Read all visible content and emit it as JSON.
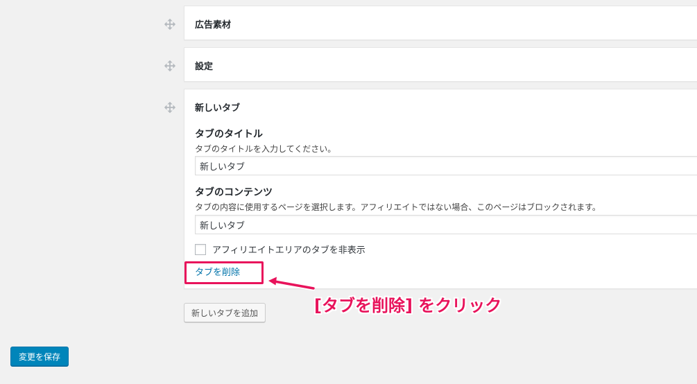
{
  "sections": [
    {
      "title": "広告素材"
    },
    {
      "title": "設定"
    },
    {
      "title": "新しいタブ"
    }
  ],
  "tab_form": {
    "title_label": "タブのタイトル",
    "title_desc": "タブのタイトルを入力してください。",
    "title_value": "新しいタブ",
    "content_label": "タブのコンテンツ",
    "content_desc": "タブの内容に使用するページを選択します。アフィリエイトではない場合、このページはブロックされます。",
    "content_value": "新しいタブ",
    "hide_checkbox_label": "アフィリエイトエリアのタブを非表示",
    "hide_checked": false,
    "delete_link": "タブを削除"
  },
  "add_tab_button": "新しいタブを追加",
  "save_button": "変更を保存",
  "annotation": {
    "text": "[タブを削除] をクリック",
    "color": "#e8135b"
  },
  "colors": {
    "link": "#0073aa",
    "primary": "#0085ba",
    "background": "#f1f1f1"
  }
}
